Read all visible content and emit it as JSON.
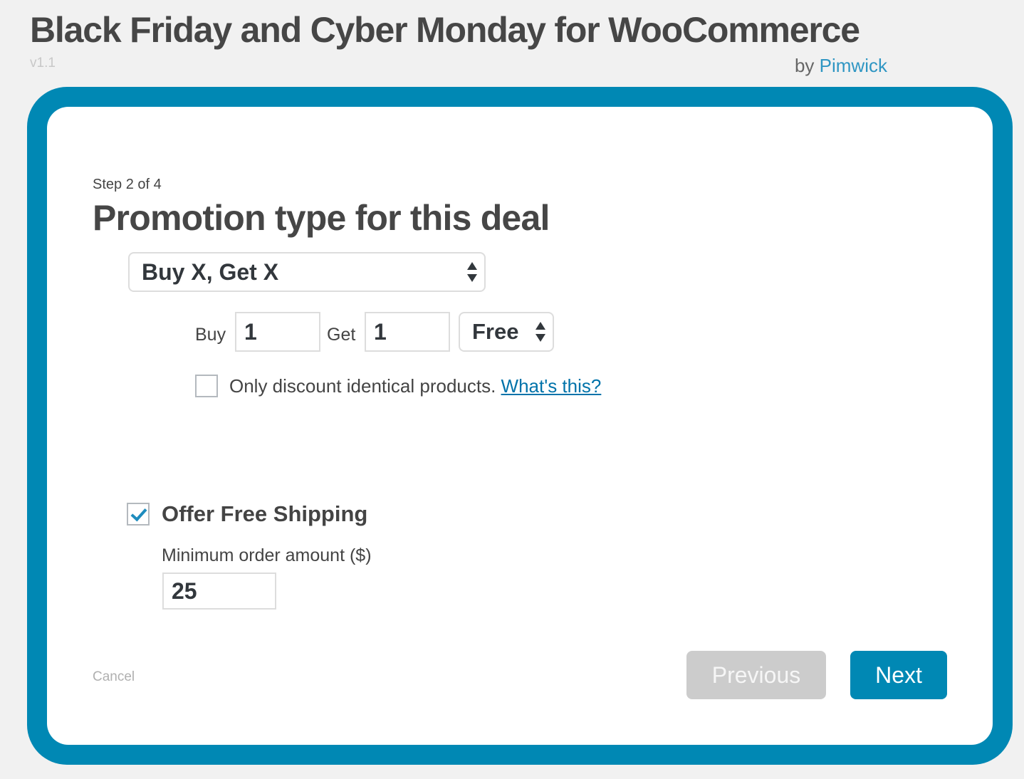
{
  "header": {
    "title": "Black Friday and Cyber Monday for WooCommerce",
    "version": "v1.1",
    "by_prefix": "by",
    "author": "Pimwick"
  },
  "wizard": {
    "step": "Step 2 of 4",
    "heading": "Promotion type for this deal",
    "promotion_type": {
      "selected": "Buy X, Get X"
    },
    "buy": {
      "label": "Buy",
      "value": "1"
    },
    "get": {
      "label": "Get",
      "value": "1"
    },
    "discount_type": {
      "selected": "Free"
    },
    "identical_products": {
      "checked": false,
      "label": "Only discount identical products.",
      "help_link": "What's this?"
    },
    "free_shipping": {
      "checked": true,
      "label": "Offer Free Shipping",
      "min_amount_label": "Minimum order amount ($)",
      "min_amount_value": "25"
    }
  },
  "footer": {
    "cancel": "Cancel",
    "previous": "Previous",
    "next": "Next"
  },
  "colors": {
    "frame": "#0088b4",
    "link": "#0073aa",
    "author_link": "#2f96c3",
    "button_disabled": "#cccccc",
    "checkmark": "#1e8cbe"
  }
}
